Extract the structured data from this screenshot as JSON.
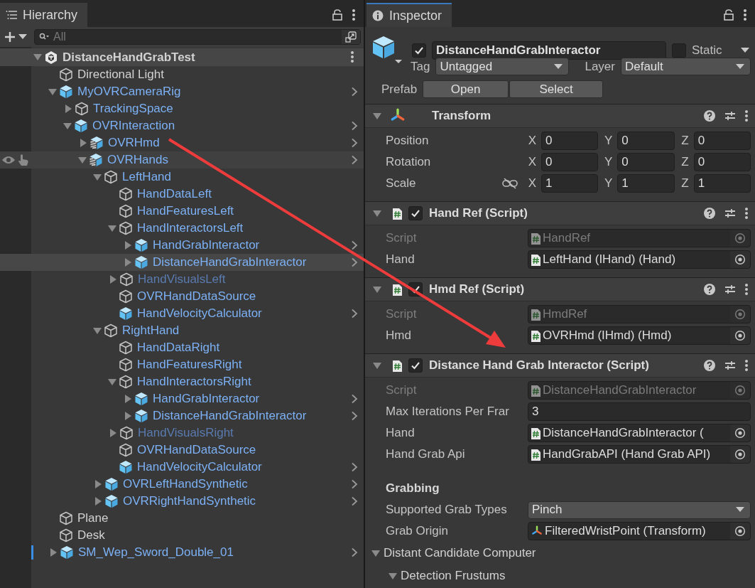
{
  "hierarchy": {
    "tab": "Hierarchy",
    "search": {
      "placeholder": "All"
    },
    "tree": {
      "name": "DistanceHandGrabTest",
      "kind": "scene",
      "expanded": true,
      "children": [
        {
          "name": "Directional Light",
          "kind": "object",
          "in_prefab": false,
          "selected": false
        },
        {
          "name": "MyOVRCameraRig",
          "kind": "prefab",
          "expanded": true,
          "chevron": true,
          "selected": false,
          "children": [
            {
              "name": "TrackingSpace",
              "kind": "object",
              "in_prefab": true,
              "expanded": false,
              "selected": false
            },
            {
              "name": "OVRInteraction",
              "kind": "prefab",
              "expanded": true,
              "chevron": true,
              "selected": false,
              "children": [
                {
                  "name": "OVRHmd",
                  "kind": "variant",
                  "expanded": false,
                  "chevron": true,
                  "selected": false
                },
                {
                  "name": "OVRHands",
                  "kind": "variant",
                  "expanded": true,
                  "chevron": true,
                  "hovered": true,
                  "selected": false,
                  "children": [
                    {
                      "name": "LeftHand",
                      "kind": "object",
                      "in_prefab": true,
                      "expanded": true,
                      "selected": false,
                      "children": [
                        {
                          "name": "HandDataLeft",
                          "kind": "object",
                          "in_prefab": true,
                          "selected": false
                        },
                        {
                          "name": "HandFeaturesLeft",
                          "kind": "object",
                          "in_prefab": true,
                          "selected": false
                        },
                        {
                          "name": "HandInteractorsLeft",
                          "kind": "object",
                          "in_prefab": true,
                          "expanded": true,
                          "selected": false,
                          "children": [
                            {
                              "name": "HandGrabInteractor",
                              "kind": "prefab",
                              "expanded": false,
                              "chevron": true,
                              "selected": false
                            },
                            {
                              "name": "DistanceHandGrabInteractor",
                              "kind": "prefab",
                              "expanded": false,
                              "chevron": true,
                              "selected": true
                            }
                          ]
                        },
                        {
                          "name": "HandVisualsLeft",
                          "kind": "object",
                          "in_prefab": true,
                          "disabled": true,
                          "expanded": false,
                          "selected": false
                        },
                        {
                          "name": "OVRHandDataSource",
                          "kind": "object",
                          "in_prefab": true,
                          "selected": false
                        },
                        {
                          "name": "HandVelocityCalculator",
                          "kind": "prefab",
                          "chevron": true,
                          "selected": false
                        }
                      ]
                    },
                    {
                      "name": "RightHand",
                      "kind": "object",
                      "in_prefab": true,
                      "expanded": true,
                      "selected": false,
                      "children": [
                        {
                          "name": "HandDataRight",
                          "kind": "object",
                          "in_prefab": true,
                          "selected": false
                        },
                        {
                          "name": "HandFeaturesRight",
                          "kind": "object",
                          "in_prefab": true,
                          "selected": false
                        },
                        {
                          "name": "HandInteractorsRight",
                          "kind": "object",
                          "in_prefab": true,
                          "expanded": true,
                          "selected": false,
                          "children": [
                            {
                              "name": "HandGrabInteractor",
                              "kind": "prefab",
                              "expanded": false,
                              "chevron": true,
                              "selected": false
                            },
                            {
                              "name": "DistanceHandGrabInteractor",
                              "kind": "prefab",
                              "expanded": false,
                              "chevron": true,
                              "selected": false
                            }
                          ]
                        },
                        {
                          "name": "HandVisualsRight",
                          "kind": "object",
                          "in_prefab": true,
                          "disabled": true,
                          "expanded": false,
                          "selected": false
                        },
                        {
                          "name": "OVRHandDataSource",
                          "kind": "object",
                          "in_prefab": true,
                          "selected": false
                        },
                        {
                          "name": "HandVelocityCalculator",
                          "kind": "prefab",
                          "chevron": true,
                          "selected": false
                        }
                      ]
                    },
                    {
                      "name": "OVRLeftHandSynthetic",
                      "kind": "prefab",
                      "expanded": false,
                      "chevron": true,
                      "selected": false
                    },
                    {
                      "name": "OVRRightHandSynthetic",
                      "kind": "prefab",
                      "expanded": false,
                      "chevron": true,
                      "selected": false
                    }
                  ]
                }
              ]
            }
          ]
        },
        {
          "name": "Plane",
          "kind": "object",
          "in_prefab": false,
          "selected": false
        },
        {
          "name": "Desk",
          "kind": "object",
          "in_prefab": false,
          "selected": false
        },
        {
          "name": "SM_Wep_Sword_Double_01",
          "kind": "prefab",
          "expanded": false,
          "chevron": true,
          "modified": true,
          "selected": false
        }
      ]
    }
  },
  "inspector": {
    "tab": "Inspector",
    "header": {
      "active": true,
      "name": "DistanceHandGrabInteractor",
      "static": false,
      "static_label": "Static",
      "tag_label": "Tag",
      "tag": "Untagged",
      "layer_label": "Layer",
      "layer": "Default",
      "prefab_label": "Prefab",
      "prefab_buttons": [
        "Open",
        "Select"
      ]
    },
    "components": [
      {
        "title": "Transform",
        "kind": "transform",
        "expanded": true,
        "rows": [
          {
            "kind": "vector",
            "label": "Position",
            "values": [
              {
                "axis": "X",
                "value": "0"
              },
              {
                "axis": "Y",
                "value": "0"
              },
              {
                "axis": "Z",
                "value": "0"
              }
            ]
          },
          {
            "kind": "vector",
            "label": "Rotation",
            "values": [
              {
                "axis": "X",
                "value": "0"
              },
              {
                "axis": "Y",
                "value": "0"
              },
              {
                "axis": "Z",
                "value": "0"
              }
            ]
          },
          {
            "kind": "vector",
            "label": "Scale",
            "constrained": false,
            "values": [
              {
                "axis": "X",
                "value": "1"
              },
              {
                "axis": "Y",
                "value": "1"
              },
              {
                "axis": "Z",
                "value": "1"
              }
            ]
          }
        ]
      },
      {
        "title": "Hand Ref (Script)",
        "kind": "script",
        "enabled": true,
        "expanded": true,
        "rows": [
          {
            "kind": "object",
            "label": "Script",
            "value": "HandRef",
            "disabled": true
          },
          {
            "kind": "object",
            "label": "Hand",
            "value": "LeftHand (IHand) (Hand)",
            "disabled": false
          }
        ]
      },
      {
        "title": "Hmd Ref (Script)",
        "kind": "script",
        "enabled": true,
        "expanded": true,
        "rows": [
          {
            "kind": "object",
            "label": "Script",
            "value": "HmdRef",
            "disabled": true
          },
          {
            "kind": "object",
            "label": "Hmd",
            "value": "OVRHmd (IHmd) (Hmd)",
            "disabled": false
          }
        ]
      },
      {
        "title": "Distance Hand Grab Interactor (Script)",
        "kind": "script",
        "enabled": true,
        "expanded": true,
        "rows": [
          {
            "kind": "object",
            "label": "Script",
            "value": "DistanceHandGrabInteractor",
            "disabled": true
          },
          {
            "kind": "text",
            "label": "Max Iterations Per Frar",
            "value": "3"
          },
          {
            "kind": "object",
            "label": "Hand",
            "value": "DistanceHandGrabInteractor (",
            "disabled": false
          },
          {
            "kind": "object",
            "label": "Hand Grab Api",
            "value": "HandGrabAPI (Hand Grab API)",
            "disabled": false
          },
          {
            "kind": "header",
            "label": "Grabbing"
          },
          {
            "kind": "dropdown",
            "label": "Supported Grab Types",
            "value": "Pinch"
          },
          {
            "kind": "transform_ref",
            "label": "Grab Origin",
            "value": "FilteredWristPoint (Transform)",
            "disabled": false
          },
          {
            "kind": "foldout",
            "label": "Distant Candidate Computer",
            "expanded": true,
            "children": [
              {
                "kind": "foldout",
                "label": "Detection Frustums",
                "expanded": true
              }
            ]
          }
        ]
      }
    ]
  }
}
